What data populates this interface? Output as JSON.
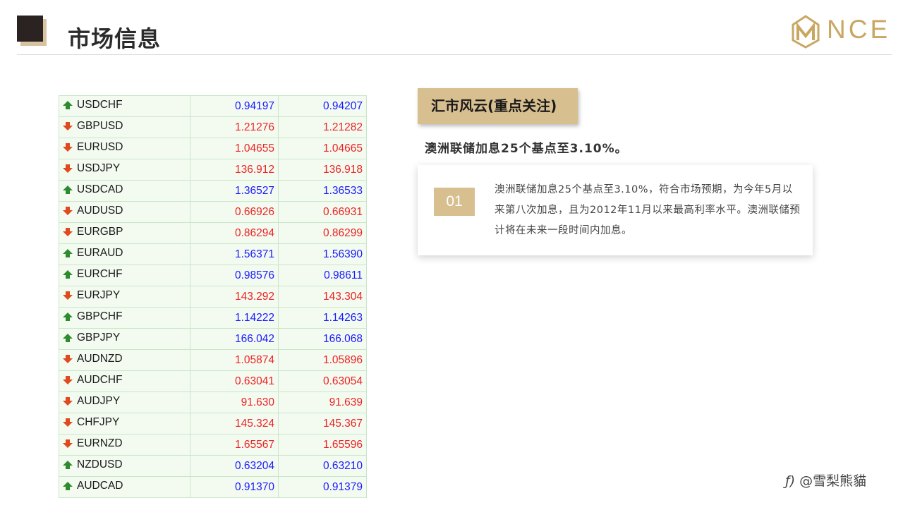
{
  "header": {
    "title": "市场信息"
  },
  "logo": {
    "text": "NCE"
  },
  "colors": {
    "gold": "#d8bf8f",
    "up": "#1a1aff",
    "down": "#ee2222",
    "arrow_up": "#2e8b2e",
    "arrow_down": "#e04a1f"
  },
  "rates": [
    {
      "pair": "USDCHF",
      "bid": "0.94197",
      "ask": "0.94207",
      "dir": "up"
    },
    {
      "pair": "GBPUSD",
      "bid": "1.21276",
      "ask": "1.21282",
      "dir": "down"
    },
    {
      "pair": "EURUSD",
      "bid": "1.04655",
      "ask": "1.04665",
      "dir": "down"
    },
    {
      "pair": "USDJPY",
      "bid": "136.912",
      "ask": "136.918",
      "dir": "down"
    },
    {
      "pair": "USDCAD",
      "bid": "1.36527",
      "ask": "1.36533",
      "dir": "up"
    },
    {
      "pair": "AUDUSD",
      "bid": "0.66926",
      "ask": "0.66931",
      "dir": "down"
    },
    {
      "pair": "EURGBP",
      "bid": "0.86294",
      "ask": "0.86299",
      "dir": "down"
    },
    {
      "pair": "EURAUD",
      "bid": "1.56371",
      "ask": "1.56390",
      "dir": "up"
    },
    {
      "pair": "EURCHF",
      "bid": "0.98576",
      "ask": "0.98611",
      "dir": "up"
    },
    {
      "pair": "EURJPY",
      "bid": "143.292",
      "ask": "143.304",
      "dir": "down"
    },
    {
      "pair": "GBPCHF",
      "bid": "1.14222",
      "ask": "1.14263",
      "dir": "up"
    },
    {
      "pair": "GBPJPY",
      "bid": "166.042",
      "ask": "166.068",
      "dir": "up"
    },
    {
      "pair": "AUDNZD",
      "bid": "1.05874",
      "ask": "1.05896",
      "dir": "down"
    },
    {
      "pair": "AUDCHF",
      "bid": "0.63041",
      "ask": "0.63054",
      "dir": "down"
    },
    {
      "pair": "AUDJPY",
      "bid": "91.630",
      "ask": "91.639",
      "dir": "down"
    },
    {
      "pair": "CHFJPY",
      "bid": "145.324",
      "ask": "145.367",
      "dir": "down"
    },
    {
      "pair": "EURNZD",
      "bid": "1.65567",
      "ask": "1.65596",
      "dir": "down"
    },
    {
      "pair": "NZDUSD",
      "bid": "0.63204",
      "ask": "0.63210",
      "dir": "up"
    },
    {
      "pair": "AUDCAD",
      "bid": "0.91370",
      "ask": "0.91379",
      "dir": "up"
    }
  ],
  "news": {
    "section_label": "汇市风云(重点关注)",
    "headline": "澳洲联储加息25个基点至3.10%。",
    "item_number": "01",
    "body": "澳洲联储加息25个基点至3.10%，符合市场预期，为今年5月以来第八次加息，且为2012年11月以来最高利率水平。澳洲联储预计将在未来一段时间内加息。"
  },
  "watermark": {
    "text": "@雪梨熊貓"
  }
}
